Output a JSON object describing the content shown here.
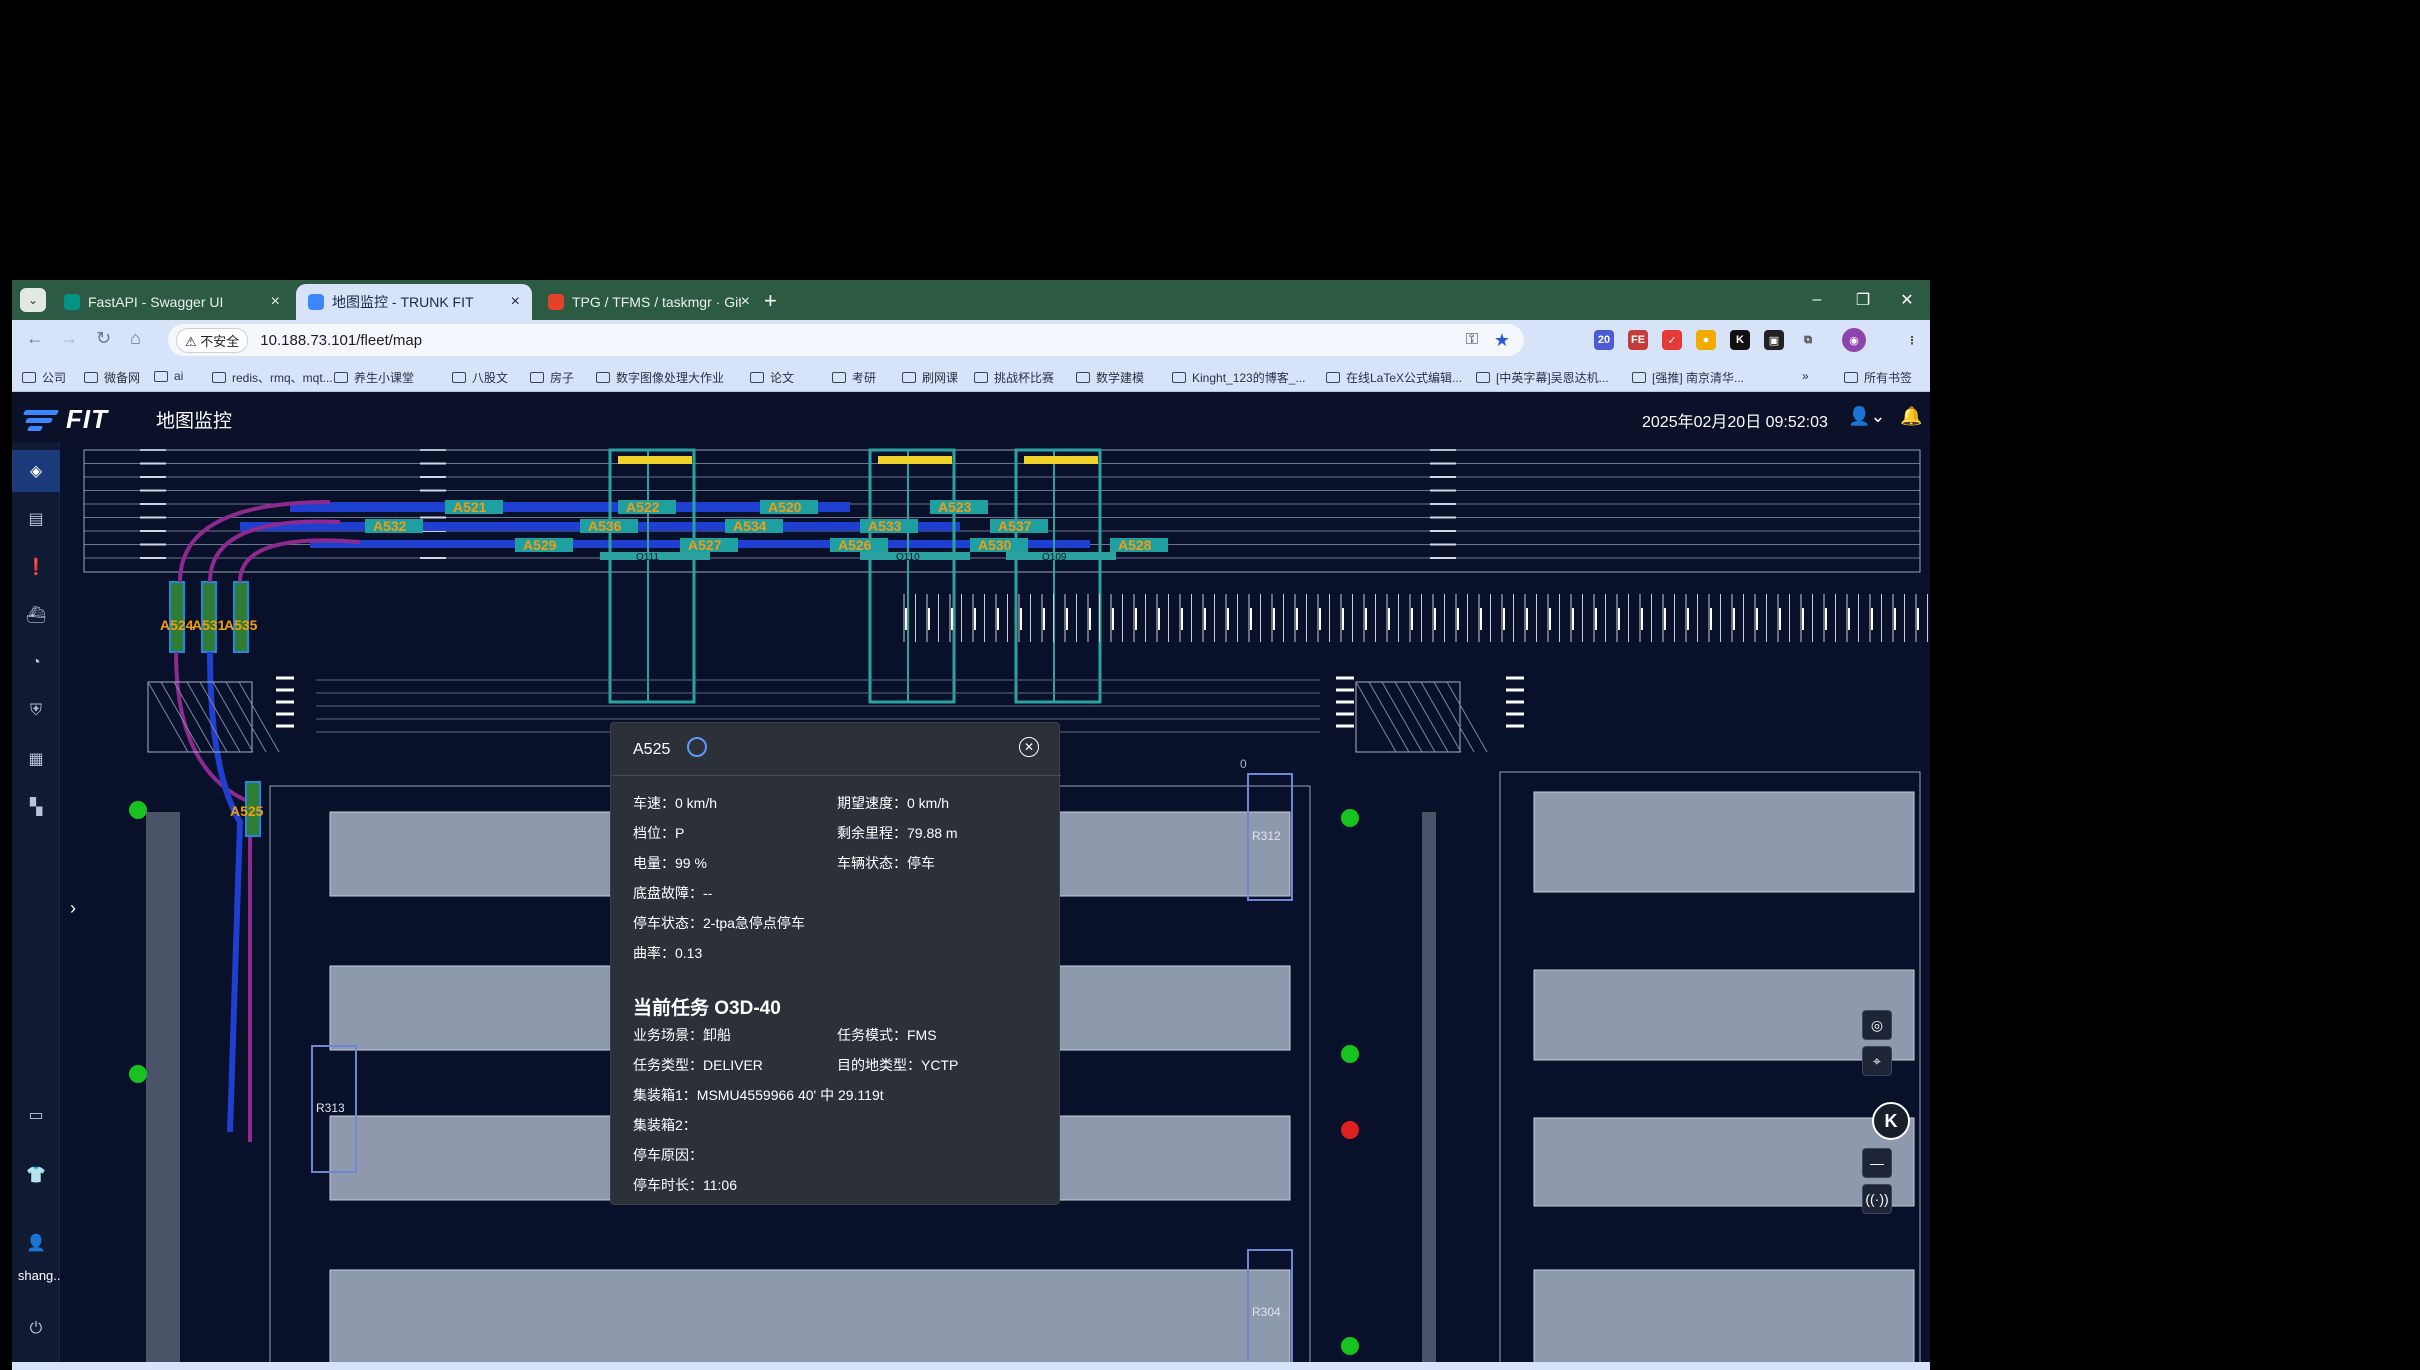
{
  "browser": {
    "tabs": [
      {
        "label": "FastAPI - Swagger UI",
        "icon": "fastapi-icon",
        "active": false
      },
      {
        "label": "地图监控 - TRUNK FIT",
        "icon": "fit-icon",
        "active": true
      },
      {
        "label": "TPG / TFMS / taskmgr · GitLa",
        "icon": "gitlab-icon",
        "active": false
      }
    ],
    "new_tab": "+",
    "security_label": "不安全",
    "url": "10.188.73.101/fleet/map",
    "extension_badge": "20",
    "bookmarks": [
      "公司",
      "微备网",
      "ai",
      "redis、rmq、mqt...",
      "养生小课堂",
      "八股文",
      "房子",
      "数字图像处理大作业",
      "论文",
      "考研",
      "刷网课",
      "挑战杯比赛",
      "数学建模",
      "Kinght_123的博客_...",
      "在线LaTeX公式编辑...",
      "[中英字幕]吴恩达机...",
      "[强推] 南京清华..."
    ],
    "bookmarks_overflow": "»",
    "all_bookmarks": "所有书签"
  },
  "app": {
    "logo_text": "FIT",
    "title": "地图监控",
    "datetime": "2025年02月20日 09:52:03",
    "username": "shang...",
    "colors": {
      "header": "#0a1128",
      "map_bg": "#08102a",
      "accent": "#3d86ff",
      "vehicle_label": "#f39c12"
    }
  },
  "map": {
    "vehicles": [
      "A521",
      "A522",
      "A520",
      "A523",
      "A532",
      "A536",
      "A534",
      "A533",
      "A537",
      "A529",
      "A527",
      "A526",
      "A530",
      "A528",
      "A524",
      "A531",
      "A535",
      "A525"
    ],
    "cranes": [
      "Q111",
      "Q110",
      "Q109"
    ],
    "blocks": [
      "R312",
      "R313",
      "R304"
    ],
    "zero_labels": [
      "0",
      "0"
    ]
  },
  "popup": {
    "vehicle_id": "A525",
    "fields_left": [
      {
        "label": "车速：",
        "value": "0 km/h"
      },
      {
        "label": "档位：",
        "value": "P"
      },
      {
        "label": "电量：",
        "value": "99 %"
      },
      {
        "label": "底盘故障：",
        "value": "--"
      },
      {
        "label": "停车状态：",
        "value": "2-tpa急停点停车"
      },
      {
        "label": "曲率：",
        "value": "0.13"
      }
    ],
    "fields_right": [
      {
        "label": "期望速度：",
        "value": "0 km/h"
      },
      {
        "label": "剩余里程：",
        "value": "79.88 m"
      },
      {
        "label": "车辆状态：",
        "value": "停车"
      }
    ],
    "task_title": "当前任务 O3D-40",
    "task_left": [
      {
        "label": "业务场景：",
        "value": "卸船"
      },
      {
        "label": "任务类型：",
        "value": "DELIVER"
      }
    ],
    "task_right": [
      {
        "label": "任务模式：",
        "value": "FMS"
      },
      {
        "label": "目的地类型：",
        "value": "YCTP"
      }
    ],
    "task_rows": [
      {
        "label": "集装箱1：",
        "value": "MSMU4559966 40' 中 29.119t"
      },
      {
        "label": "集装箱2：",
        "value": ""
      },
      {
        "label": "停车原因：",
        "value": ""
      },
      {
        "label": "停车时长：",
        "value": "11:06"
      }
    ]
  }
}
